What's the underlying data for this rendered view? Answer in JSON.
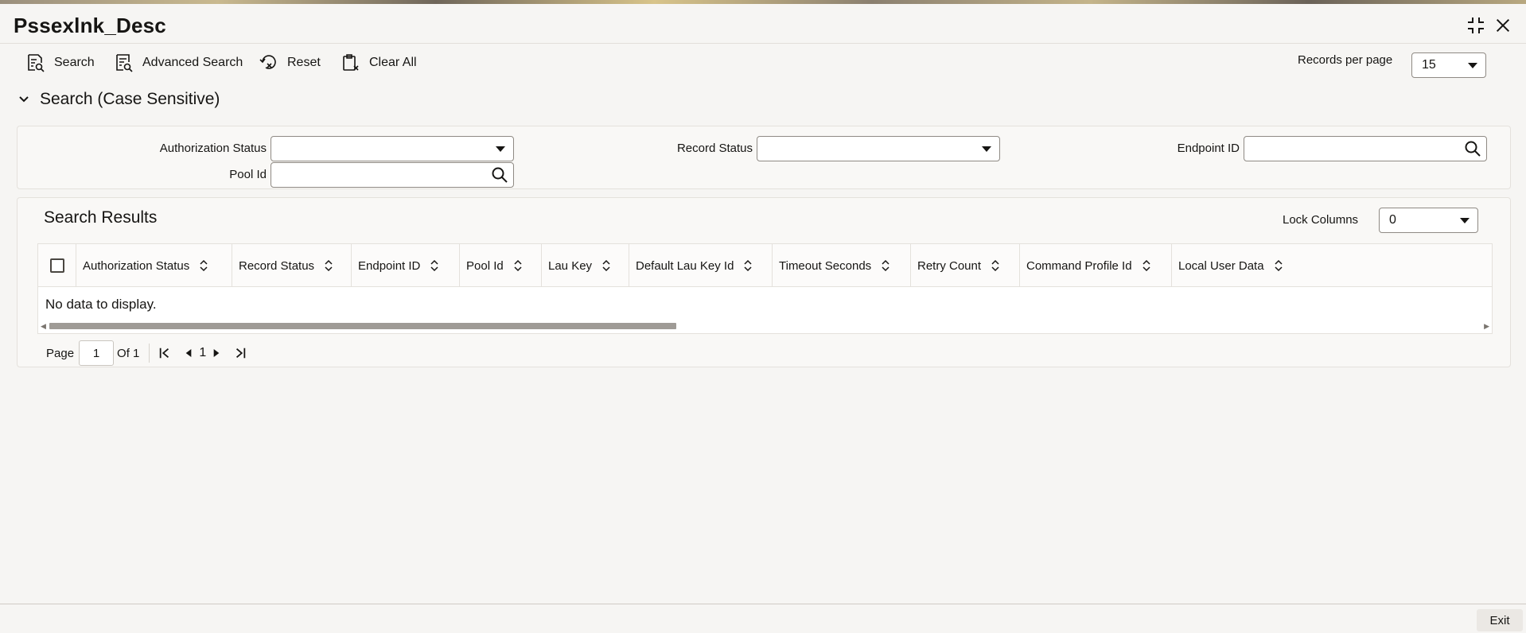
{
  "window": {
    "title": "Pssexlnk_Desc"
  },
  "toolbar": {
    "search_label": "Search",
    "advanced_search_label": "Advanced Search",
    "reset_label": "Reset",
    "clear_all_label": "Clear All",
    "records_per_page_label": "Records per page",
    "records_per_page_value": "15"
  },
  "search_section": {
    "title": "Search (Case Sensitive)",
    "fields": {
      "authorization_status": {
        "label": "Authorization Status",
        "value": ""
      },
      "record_status": {
        "label": "Record Status",
        "value": ""
      },
      "endpoint_id": {
        "label": "Endpoint ID",
        "value": ""
      },
      "pool_id": {
        "label": "Pool Id",
        "value": ""
      }
    }
  },
  "results": {
    "title": "Search Results",
    "lock_columns_label": "Lock Columns",
    "lock_columns_value": "0",
    "columns": [
      "Authorization Status",
      "Record Status",
      "Endpoint ID",
      "Pool Id",
      "Lau Key",
      "Default Lau Key Id",
      "Timeout Seconds",
      "Retry Count",
      "Command Profile Id",
      "Local User Data"
    ],
    "empty_text": "No data to display."
  },
  "pagination": {
    "page_label": "Page",
    "page_value": "1",
    "of_label": "Of 1",
    "current_page": "1"
  },
  "footer": {
    "exit_label": "Exit"
  },
  "icons": {
    "search": "search-icon",
    "advanced_search": "advanced-search-icon",
    "reset": "reset-icon",
    "clear_all": "clear-all-icon",
    "minimize": "minimize-icon",
    "close": "close-icon"
  }
}
